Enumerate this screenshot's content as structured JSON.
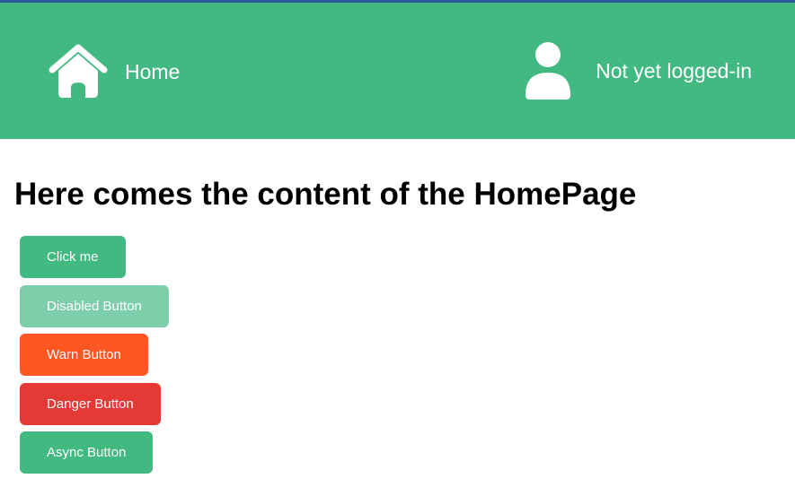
{
  "header": {
    "home_icon": "home-icon",
    "home_label": "Home",
    "user_icon": "user-icon",
    "user_status": "Not yet logged-in",
    "background_color": "#43b982"
  },
  "main": {
    "title": "Here comes the content of the HomePage",
    "buttons": [
      {
        "label": "Click me",
        "variant": "primary",
        "color": "#43b982",
        "disabled": false
      },
      {
        "label": "Disabled Button",
        "variant": "disabled",
        "color": "#7dceab",
        "disabled": true
      },
      {
        "label": "Warn Button",
        "variant": "warn",
        "color": "#ff5722",
        "disabled": false
      },
      {
        "label": "Danger Button",
        "variant": "danger",
        "color": "#e53935",
        "disabled": false
      },
      {
        "label": "Async Button",
        "variant": "async",
        "color": "#43b982",
        "disabled": false
      }
    ]
  }
}
